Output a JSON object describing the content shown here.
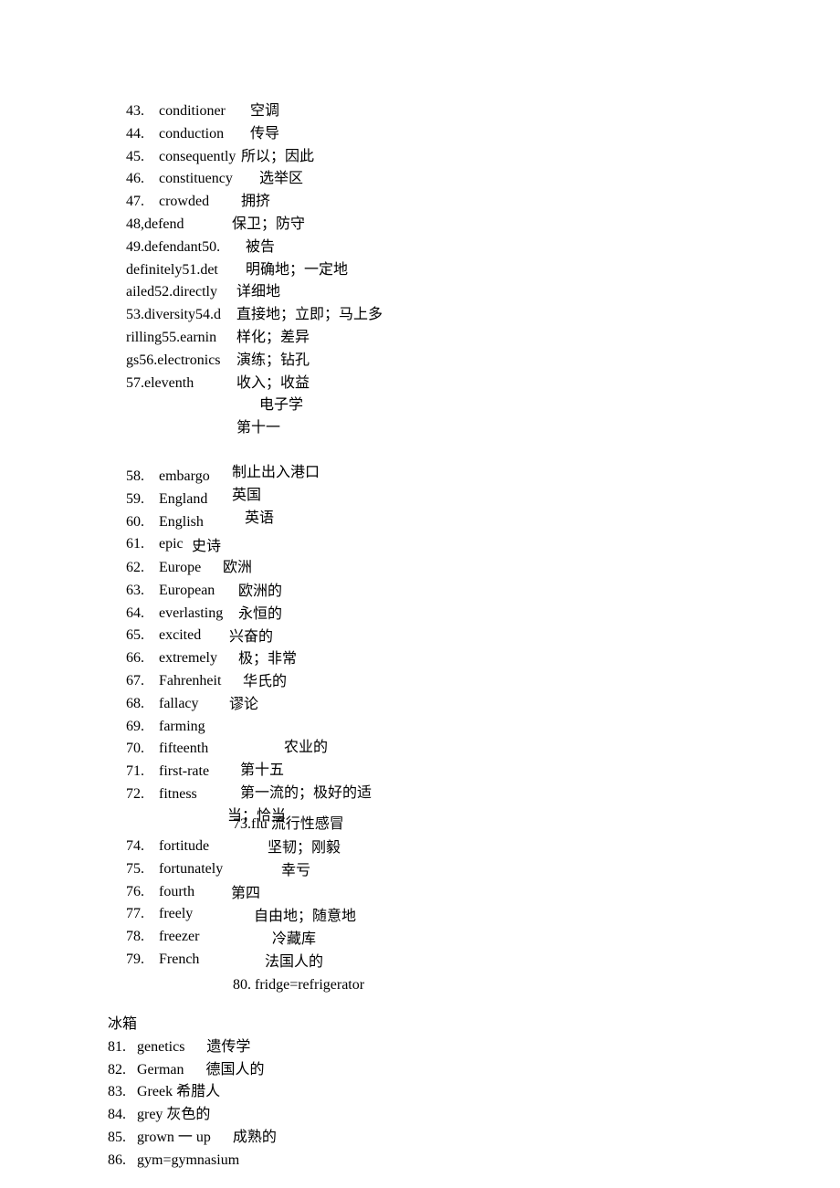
{
  "b1": {
    "nums": [
      "43.",
      "44.",
      "45.",
      "46.",
      "47."
    ],
    "en_col1": "conditioner\nconduction\nconsequently\nconstituency\ncrowded",
    "en_col2": "48,defend\n49.defendant50.\ndefinitely51.det\nailed52.directly\n53.diversity54.d\nrilling55.earnin\ngs56.electronics\n57.eleventh",
    "zh": [
      "空调",
      "传导",
      "所以；因此",
      "选举区",
      "拥挤",
      "保卫；防守",
      "被告",
      "明确地；一定地",
      "详细地",
      "直接地；立即；马上多",
      "样化；差异",
      "演练；钻孔",
      "收入；收益",
      "电子学",
      "第十一"
    ]
  },
  "b2": {
    "nums": [
      "58.",
      "59.",
      "60.",
      "61."
    ],
    "en_col1": "embargo\nEngland\nEnglish\nepic",
    "zh": [
      "制止出入港口",
      "英国",
      "英语"
    ],
    "zh_epic": "史诗"
  },
  "b3": {
    "nums": [
      "62.",
      "63.",
      "64.",
      "65.",
      "66.",
      "67.",
      "68.",
      "69.",
      "70.",
      "71.",
      "72."
    ],
    "en_col1": "Europe\nEuropean\neverlasting\nexcited\nextremely\nFahrenheit\nfallacy\nfarming\nfifteenth\nfirst-rate\nfitness",
    "zh_top": [
      "欧洲"
    ],
    "zh_right": [
      "欧洲的",
      "永恒的",
      "兴奋的",
      "极；非常",
      "华氏的",
      "谬论"
    ],
    "zh_farming": "农业的",
    "zh_bottom": [
      "第十五",
      "第一流的；极好的适",
      "当；恰当"
    ]
  },
  "b4": {
    "flu": "73.flu 流行性感冒",
    "nums": [
      "74.",
      "75.",
      "76.",
      "77.",
      "78.",
      "79."
    ],
    "en_col1": "fortitude\nfortunately\nfourth\nfreely\nfreezer\nFrench",
    "zh_fortitude": "坚韧；刚毅",
    "zh_fortunately": "幸亏",
    "zh_fourth": "第四",
    "zh_freely": "自由地；随意地",
    "zh_freezer": "冷藏库",
    "zh_french": "法国人的",
    "fridge": "80.  fridge=refrigerator"
  },
  "b5": {
    "lines": [
      "冰箱",
      "81.   genetics      遗传学",
      "82.   German      德国人的",
      "83.   Greek 希腊人",
      "84.   grey 灰色的",
      "85.   grown 一 up      成熟的",
      "86.   gym=gymnasium"
    ]
  }
}
